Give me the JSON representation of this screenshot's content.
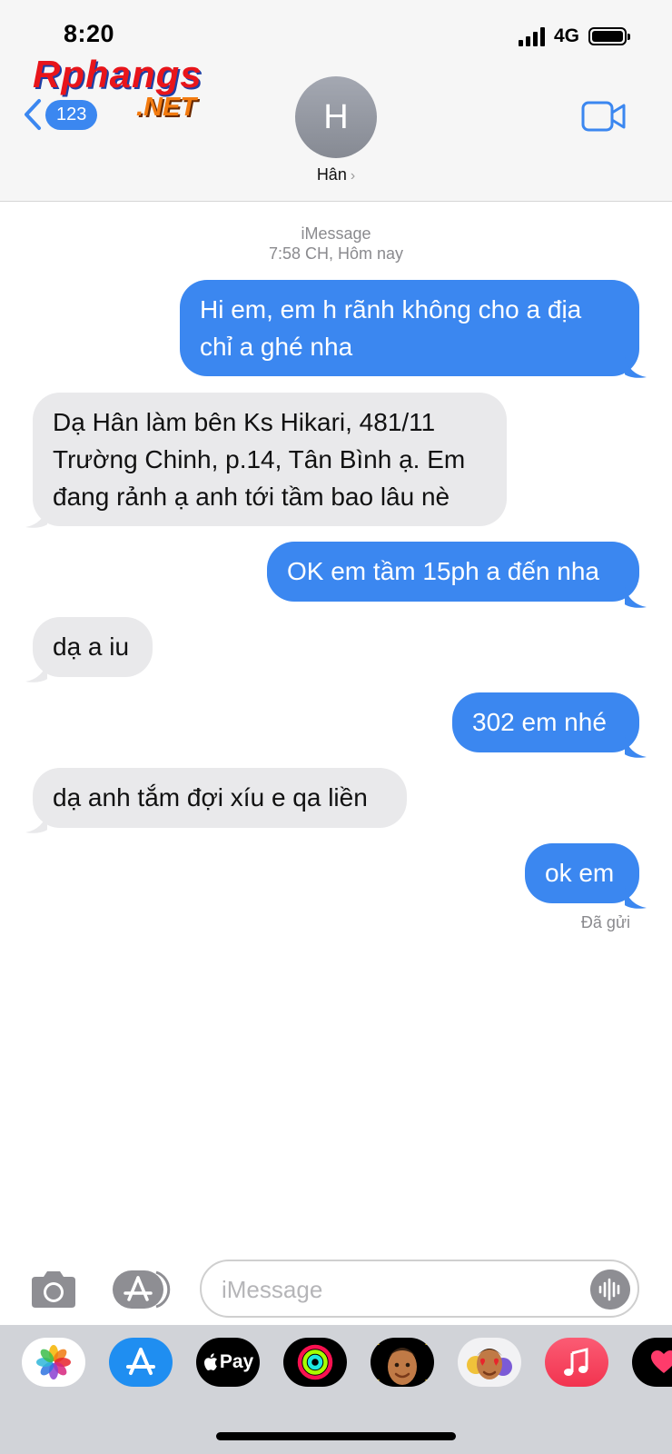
{
  "status": {
    "time": "8:20",
    "network": "4G"
  },
  "logo": {
    "line1": "Rphangs",
    "line2": ".NET"
  },
  "nav": {
    "back_count": "123",
    "avatar_initial": "H",
    "contact_name": "Hân",
    "contact_chevron": "›"
  },
  "thread": {
    "service": "iMessage",
    "timestamp": "7:58 CH, Hôm nay",
    "messages": [
      {
        "dir": "sent",
        "lines": [
          "Hi em, em h rãnh không cho a địa",
          "chỉ a ghé nha"
        ]
      },
      {
        "dir": "received",
        "lines": [
          "Dạ Hân làm bên Ks Hikari, 481/11",
          "Trường Chinh, p.14, Tân Bình ạ. Em",
          "đang rảnh ạ anh tới tầm bao lâu nè"
        ]
      },
      {
        "dir": "sent",
        "lines": [
          "OK em tầm 15ph a đến nha"
        ]
      },
      {
        "dir": "received",
        "lines": [
          "dạ a iu"
        ]
      },
      {
        "dir": "sent",
        "lines": [
          "302 em nhé"
        ]
      },
      {
        "dir": "received",
        "lines": [
          "dạ anh tắm đợi xíu e qa liền"
        ]
      },
      {
        "dir": "sent",
        "lines": [
          "ok em"
        ]
      }
    ],
    "delivery_status": "Đã gửi"
  },
  "input": {
    "placeholder": "iMessage"
  },
  "drawer": {
    "apps": [
      {
        "name": "photos-app-icon"
      },
      {
        "name": "app-store-app-icon"
      },
      {
        "name": "apple-pay-app-icon",
        "label": "Pay"
      },
      {
        "name": "activity-app-icon"
      },
      {
        "name": "memoji-app-icon"
      },
      {
        "name": "animoji-stickers-app-icon"
      },
      {
        "name": "music-app-icon"
      },
      {
        "name": "digital-touch-app-icon"
      }
    ]
  },
  "colors": {
    "sent_bubble": "#3b87f0",
    "received_bubble": "#e9e9eb",
    "accent": "#3b87f0"
  }
}
